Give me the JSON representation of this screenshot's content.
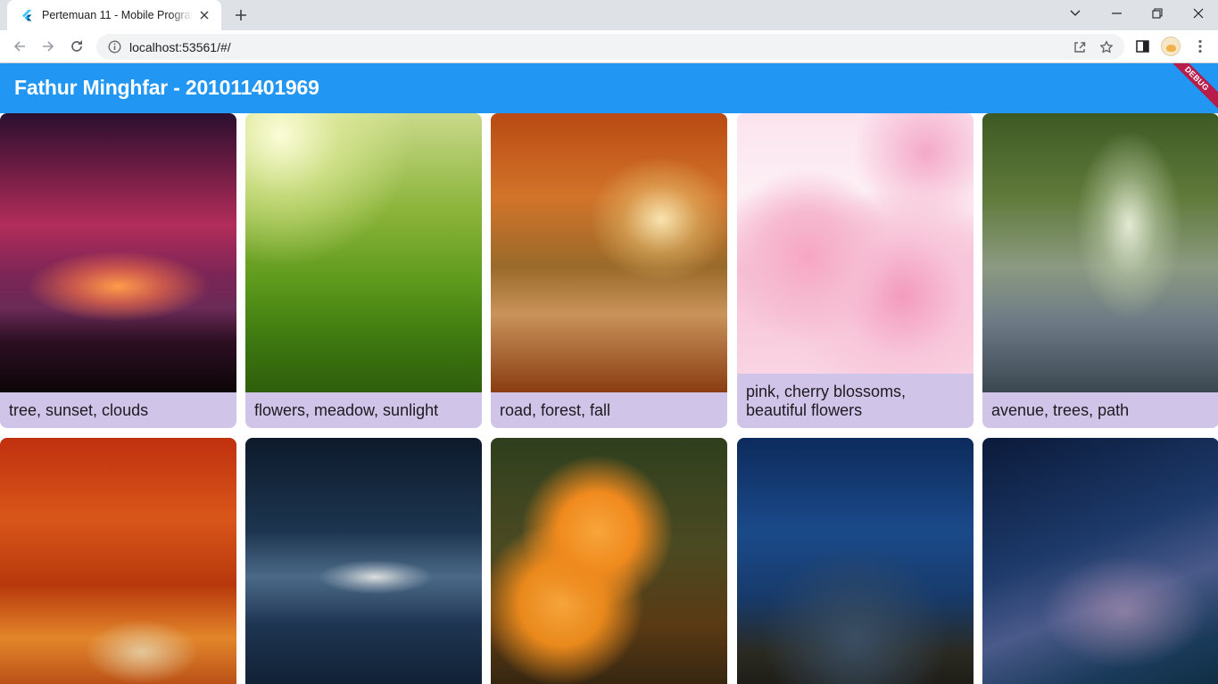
{
  "browser": {
    "tab_title": "Pertemuan 11 - Mobile Programming",
    "url": "localhost:53561/#/",
    "icons": {
      "favicon": "flutter-icon",
      "tab_close": "close-icon",
      "new_tab": "plus-icon",
      "tab_search": "chevron-down-icon",
      "minimize": "minimize-icon",
      "maximize": "restore-icon",
      "close_window": "close-icon",
      "back": "arrow-left-icon",
      "forward": "arrow-right-icon",
      "reload": "reload-icon",
      "site_info": "info-icon",
      "share": "share-icon",
      "bookmark": "star-icon",
      "side_panel": "side-panel-icon",
      "profile": "avatar",
      "menu": "kebab-menu-icon"
    }
  },
  "app": {
    "title": "Fathur Minghfar - 201011401969",
    "debug_banner": "DEBUG",
    "appbar_color": "#2196f3",
    "caption_bg_color": "#d1c4e9"
  },
  "grid": {
    "items": [
      {
        "caption": "tree, sunset, clouds"
      },
      {
        "caption": "flowers, meadow, sunlight"
      },
      {
        "caption": "road, forest, fall"
      },
      {
        "caption": "pink, cherry blossoms, beautiful flowers"
      },
      {
        "caption": "avenue, trees, path"
      },
      {
        "caption": ""
      },
      {
        "caption": ""
      },
      {
        "caption": ""
      },
      {
        "caption": ""
      },
      {
        "caption": ""
      }
    ]
  }
}
